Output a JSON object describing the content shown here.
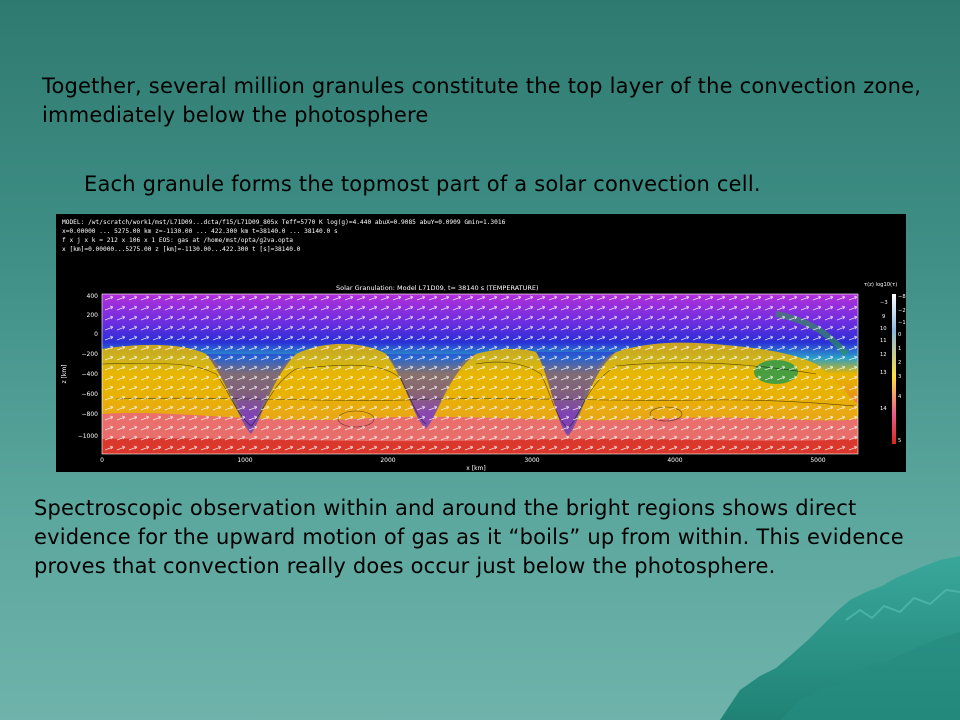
{
  "slide": {
    "paragraph_top": "Together, several million granules constitute the top layer of the convection zone, immediately below the photosphere",
    "paragraph_middle": "Each granule forms the topmost part of a solar convection cell.",
    "paragraph_bottom": "Spectroscopic observation within and around the bright regions shows direct evidence for the upward motion of gas as it “boils” up from within. This evidence proves that convection really does occur just below the photosphere."
  },
  "figure": {
    "header_lines": [
      "MODEL: /wt/scratch/work1/mst/L71D09...dcta/f15/L71D09_805x   Teff=5770 K   log(g)=4.440  abuX=0.9085  abuY=0.0909  Gmin=1.3016",
      "x=0.00000 ... 5275.00 km    z=-1130.00 ... 422.300 km    t=38140.0 ... 38140.0 s",
      "f x j x k = 212 x 106 x 1   EOS: gas  at /home/mst/opta/g2va.opta",
      "x [km]=0.00000...5275.00  z [km]=-1130.00...422.300  t [s]=38140.0"
    ],
    "plot_title": "Solar Granulation: Model L71D09, t= 38140 s   (TEMPERATURE)",
    "xlabel": "x [km]",
    "ylabel": "z [km]",
    "x_ticks": [
      "0",
      "1000",
      "2000",
      "3000",
      "4000",
      "5000"
    ],
    "y_ticks": [
      "400",
      "200",
      "0",
      "−200",
      "−400",
      "−600",
      "−800",
      "−1000"
    ],
    "colorbar_header": "τ(z)  log10(τ)",
    "colorbar_labels": [
      "−8",
      "−3",
      "−2",
      "9",
      "−1",
      "10",
      "0",
      "11",
      "1",
      "12",
      "2",
      "13",
      "3",
      "14",
      "4",
      "5"
    ],
    "colors": {
      "hot": "#d62a1e",
      "warm": "#e8b600",
      "cool": "#2a2fd6",
      "coolest": "#b230d8",
      "green": "#2d9a4a"
    }
  },
  "background": {
    "colors": {
      "teal_top": "#2f7a70",
      "teal_bottom": "#6fb3ab",
      "mountain": "#2c9a8f"
    }
  }
}
